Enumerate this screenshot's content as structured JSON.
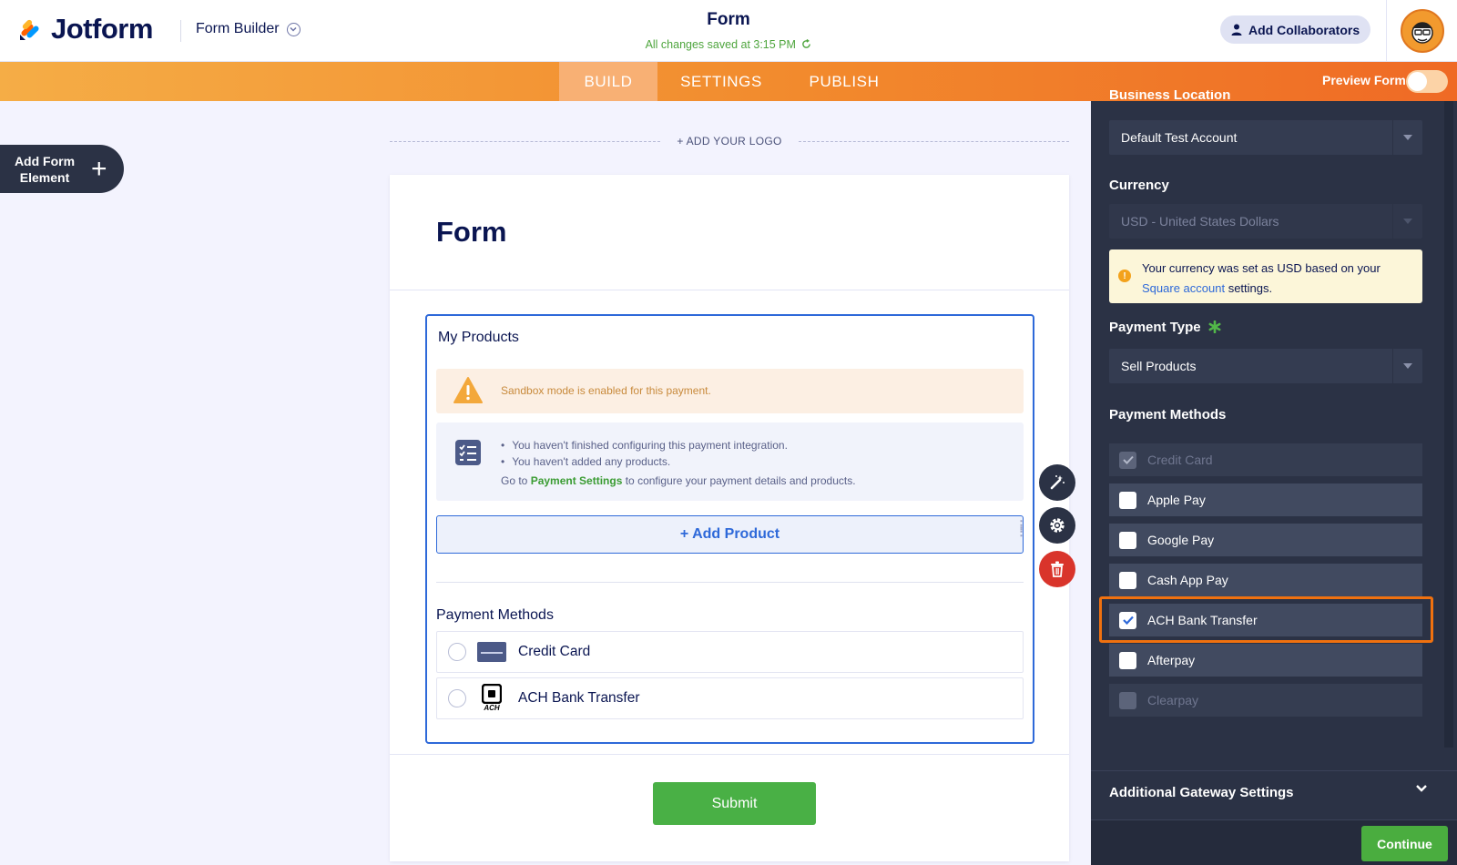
{
  "header": {
    "brand": "Jotform",
    "builder_menu": "Form Builder",
    "form_title": "Form",
    "saved_status": "All changes saved at 3:15 PM",
    "collaborators_button": "Add Collaborators"
  },
  "nav": {
    "tabs": [
      {
        "label": "BUILD",
        "active": true
      },
      {
        "label": "SETTINGS",
        "active": false
      },
      {
        "label": "PUBLISH",
        "active": false
      }
    ],
    "preview_label": "Preview Form"
  },
  "left": {
    "add_element_line1": "Add Form",
    "add_element_line2": "Element"
  },
  "canvas": {
    "add_logo": "+ ADD YOUR LOGO",
    "form_heading": "Form",
    "products": {
      "label": "My Products",
      "sandbox_notice": "Sandbox mode is enabled for this payment.",
      "info_items": [
        "You haven't finished configuring this payment integration.",
        "You haven't added any products."
      ],
      "info_go_prefix": "Go to ",
      "info_go_link": "Payment Settings",
      "info_go_suffix": " to configure your payment details and products.",
      "add_product": "+ Add Product",
      "payment_methods_label": "Payment Methods",
      "methods": [
        {
          "label": "Credit Card",
          "icon": "credit-card-icon"
        },
        {
          "label": "ACH Bank Transfer",
          "icon": "square-ach-icon",
          "icon_caption": "ACH"
        }
      ]
    },
    "submit": "Submit"
  },
  "panel": {
    "business_location_label": "Business Location",
    "business_location_value": "Default Test Account",
    "currency_label": "Currency",
    "currency_value": "USD - United States Dollars",
    "currency_notice_1": "Your currency was set as USD based on your",
    "currency_notice_link": "Square account",
    "currency_notice_2": " settings.",
    "payment_type_label": "Payment Type",
    "payment_type_value": "Sell Products",
    "payment_methods_label": "Payment Methods",
    "methods": [
      {
        "label": "Credit Card",
        "checked": true,
        "disabled": true
      },
      {
        "label": "Apple Pay",
        "checked": false,
        "disabled": false
      },
      {
        "label": "Google Pay",
        "checked": false,
        "disabled": false
      },
      {
        "label": "Cash App Pay",
        "checked": false,
        "disabled": false
      },
      {
        "label": "ACH Bank Transfer",
        "checked": true,
        "disabled": false
      },
      {
        "label": "Afterpay",
        "checked": false,
        "disabled": false
      },
      {
        "label": "Clearpay",
        "checked": false,
        "disabled": true
      }
    ],
    "gateway_settings": "Additional Gateway Settings",
    "continue": "Continue"
  },
  "colors": {
    "accent": "#f28a2d",
    "primary_blue": "#2e69d9",
    "success": "#49b045",
    "panel_bg": "#2b3245",
    "highlight": "#f0710f"
  }
}
